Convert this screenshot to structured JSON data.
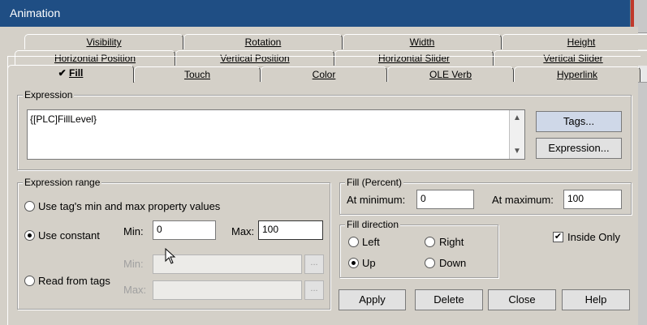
{
  "window": {
    "title": "Animation"
  },
  "tabs": {
    "row1": [
      "Visibility",
      "Rotation",
      "Width",
      "Height"
    ],
    "row2": [
      "Horizontal Position",
      "Vertical Position",
      "Horizontal Slider",
      "Vertical Slider"
    ],
    "row3": [
      "Fill",
      "Touch",
      "Color",
      "OLE Verb",
      "Hyperlink"
    ],
    "active_check": "✔"
  },
  "expression": {
    "group_label": "Expression",
    "value": "{[PLC]FillLevel}",
    "tags_button": "Tags...",
    "expression_button": "Expression..."
  },
  "range": {
    "group_label": "Expression range",
    "option_tag_minmax": "Use tag's min and max property values",
    "option_constant": "Use constant",
    "option_read_tags": "Read from tags",
    "min_label": "Min:",
    "max_label": "Max:",
    "min_value": "0",
    "max_value": "100",
    "tags_min_label": "Min:",
    "tags_max_label": "Max:",
    "browse": "..."
  },
  "fill_percent": {
    "group_label": "Fill (Percent)",
    "at_min_label": "At minimum:",
    "at_min_value": "0",
    "at_max_label": "At maximum:",
    "at_max_value": "100"
  },
  "fill_direction": {
    "group_label": "Fill direction",
    "left": "Left",
    "right": "Right",
    "up": "Up",
    "down": "Down"
  },
  "inside_only": {
    "label": "Inside Only",
    "checked": true,
    "mark": "✔"
  },
  "buttons": {
    "apply": "Apply",
    "delete": "Delete",
    "close": "Close",
    "help": "Help"
  }
}
